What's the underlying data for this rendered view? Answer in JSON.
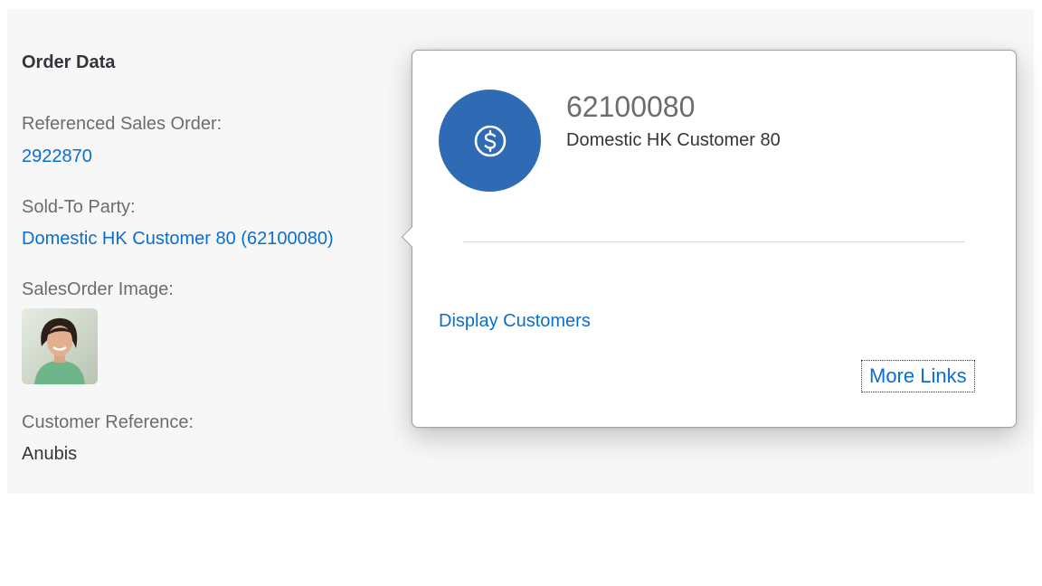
{
  "order_data": {
    "section_title": "Order Data",
    "referenced_sales_order_label": "Referenced Sales Order:",
    "referenced_sales_order_value": "2922870",
    "sold_to_party_label": "Sold-To Party:",
    "sold_to_party_value": "Domestic HK Customer 80 (62100080)",
    "sales_order_image_label": "SalesOrder Image:",
    "customer_reference_label": "Customer Reference:",
    "customer_reference_value": "Anubis"
  },
  "popover": {
    "icon": "dollar-icon",
    "title": "62100080",
    "subtitle": "Domestic HK Customer 80",
    "link_display_customers": "Display Customers",
    "more_links": "More Links"
  },
  "colors": {
    "link": "#0a6ed1",
    "avatar_bg": "#2e6bb4",
    "panel_bg": "#f7f7f7"
  }
}
